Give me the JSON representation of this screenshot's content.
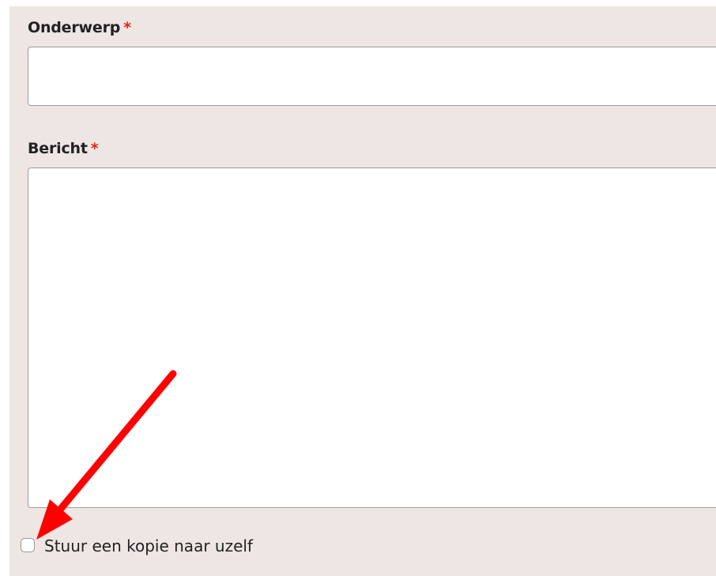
{
  "form": {
    "subject": {
      "label": "Onderwerp",
      "required_mark": "*",
      "value": ""
    },
    "message": {
      "label": "Bericht",
      "required_mark": "*",
      "value": ""
    },
    "copy_checkbox": {
      "label": "Stuur een kopie naar uzelf",
      "checked": false
    }
  },
  "colors": {
    "panel_background": "#ede6e2",
    "required_mark": "#e3241b",
    "annotation_arrow": "#ff0000"
  },
  "annotation": {
    "icon": "red-arrow-icon"
  }
}
